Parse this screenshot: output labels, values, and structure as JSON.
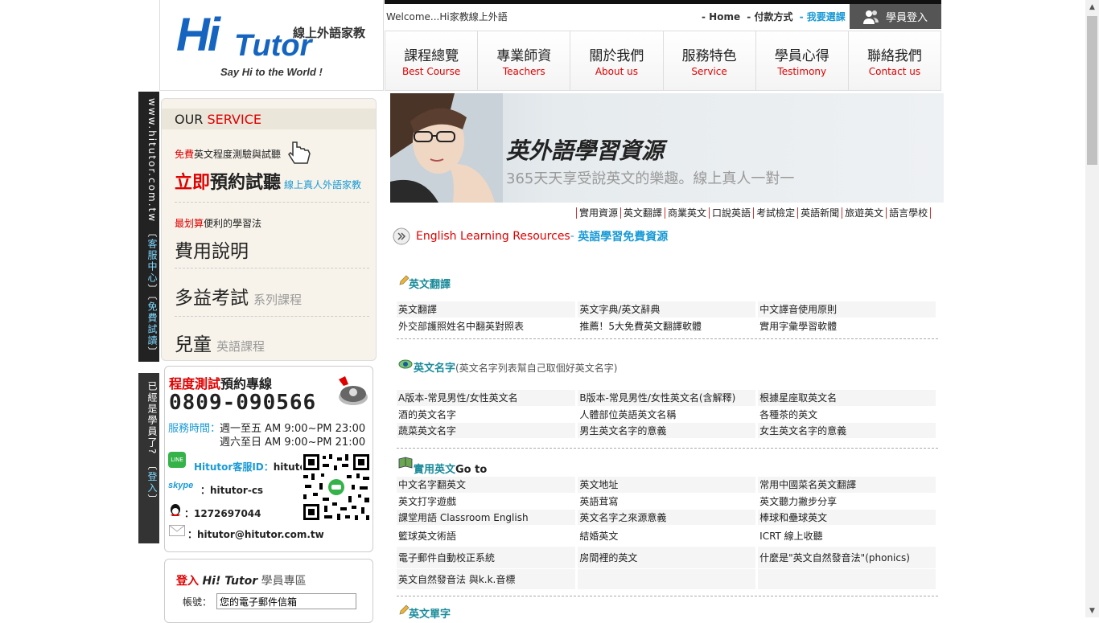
{
  "header": {
    "logo_hi": "Hi",
    "logo_tutor": "Tutor",
    "logo_cn": "線上外語家教",
    "logo_tagline": "Say Hi to the World !",
    "welcome": "Welcome...Hi家教線上外語",
    "top_links": [
      "- Home",
      "- 付款方式",
      "- 我要選課"
    ],
    "login_label": "學員登入"
  },
  "nav": [
    {
      "cn": "課程總覽",
      "en": "Best Course"
    },
    {
      "cn": "專業師資",
      "en": "Teachers"
    },
    {
      "cn": "關於我們",
      "en": "About us"
    },
    {
      "cn": "服務特色",
      "en": "Service"
    },
    {
      "cn": "學員心得",
      "en": "Testimony"
    },
    {
      "cn": "聯絡我們",
      "en": "Contact us"
    }
  ],
  "side_vertical": {
    "url": "www.hitutor.com.tw",
    "links": [
      "〔",
      "客服中心",
      "〕〔",
      "免費試讀",
      "〕"
    ],
    "member_text": "已經是學員了?",
    "member_link_open": "〔",
    "member_link": "登入",
    "member_link_close": "〕"
  },
  "service": {
    "head_our": "OUR ",
    "head_service": "SERVICE",
    "item1_free": "免費",
    "item1_text": "英文程度測驗與試聽",
    "item1_big_red": "立即",
    "item1_big": "預約試聽",
    "item1_sub": "線上真人外語家教",
    "item2_red": "最划算",
    "item2_text": "便利的學習法",
    "item2_big": "費用說明",
    "item3_big": "多益考試",
    "item3_sub": "系列課程",
    "item4_big": "兒童",
    "item4_sub": "英語課程"
  },
  "contact": {
    "title_red": "程度測試",
    "title": "預約專線",
    "phone": "0809-090566",
    "hours_label": "服務時間：",
    "hours1": "週一至五 AM 9:00~PM 23:00",
    "hours2": "週六至日 AM 9:00~PM 21:00",
    "line_label": "Hitutor客服ID：",
    "line_id": "hitutor",
    "skype_label": "skype",
    "skype_id": "：hitutor-cs",
    "qq_id": "：1272697044",
    "email": "：hitutor@hitutor.com.tw"
  },
  "member_login": {
    "title_red": "登入",
    "title_brand": "Hi! Tutor",
    "title": "學員專區",
    "account_label": "帳號：",
    "account_placeholder": "您的電子郵件信箱"
  },
  "banner": {
    "title": "英外語學習資源",
    "subtitle": "365天天享受說英文的樂趣。線上真人一對一"
  },
  "subnav": [
    "實用資源",
    "英文翻譯",
    "商業英文",
    "口說英語",
    "考試檢定",
    "英語新聞",
    "旅遊英文",
    "語言學校"
  ],
  "section": {
    "title_en": "English Learning Resources",
    "dash": "- ",
    "title_cn": "英語學習免費資源"
  },
  "categories": {
    "translate": {
      "title": "英文翻譯",
      "rows": [
        [
          "英文翻譯",
          "英文字典/英文辭典",
          "中文譯音使用原則"
        ],
        [
          "外交部護照姓名中翻英對照表",
          "推薦！5大免費英文翻譯軟體",
          "實用字彙學習軟體"
        ]
      ]
    },
    "names": {
      "title": "英文名字",
      "sub": "(英文名字列表幫自己取個好英文名字)",
      "rows": [
        [
          "A版本-常見男性/女性英文名",
          "B版本-常見男性/女性英文名(含解釋)",
          "根據星座取英文名"
        ],
        [
          "酒的英文名字",
          "人體部位英語英文名稱",
          "各種茶的英文"
        ],
        [
          "蔬菜英文名字",
          "男生英文名字的意義",
          "女生英文名字的意義"
        ]
      ]
    },
    "practical": {
      "title": "實用英文",
      "sub": "Go to",
      "rows": [
        [
          "中文名字翻英文",
          "英文地址",
          "常用中國菜名英文翻譯"
        ],
        [
          "英文打字遊戲",
          "英語茸寫",
          "英文聽力撇步分享"
        ],
        [
          "課堂用語 Classroom English",
          "英文名字之來源意義",
          "棒球和壘球英文"
        ],
        [
          "籃球英文術語",
          "結婚英文",
          "ICRT 線上收聽"
        ],
        [
          "電子郵件自動校正系統",
          "房間裡的英文",
          "什麼是\"英文自然發音法\"(phonics)"
        ],
        [
          "英文自然發音法 與k.k.音標",
          "",
          ""
        ]
      ]
    },
    "vocab": {
      "title": "英文單字"
    }
  }
}
